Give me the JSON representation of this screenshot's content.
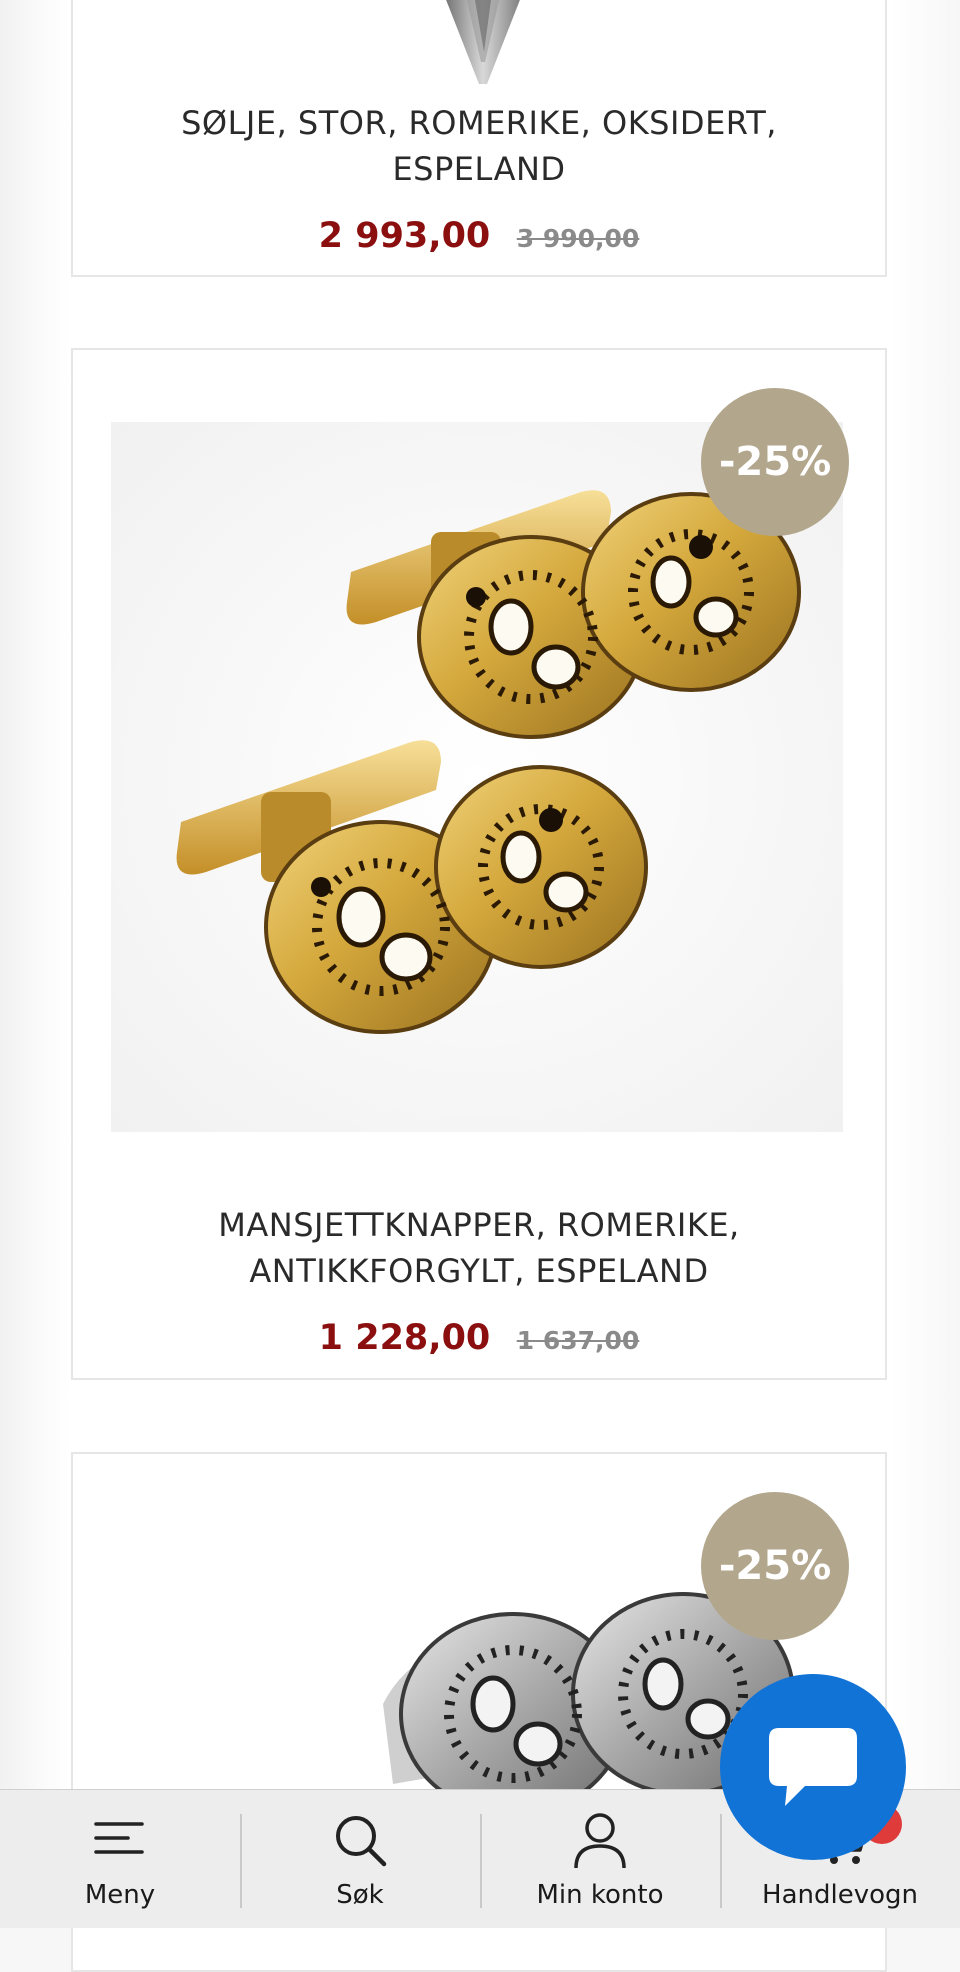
{
  "products": [
    {
      "title": "SØLJE, STOR, ROMERIKE, OKSIDERT, ESPELAND",
      "price": "2 993,00",
      "old_price": "3 990,00"
    },
    {
      "title": "MANSJETTKNAPPER, ROMERIKE, ANTIKKFORGYLT, ESPELAND",
      "price": "1 228,00",
      "old_price": "1 637,00",
      "badge": "-25%"
    },
    {
      "badge": "-25%"
    }
  ],
  "nav": {
    "menu_label": "Meny",
    "search_label": "Søk",
    "account_label": "Min konto",
    "cart_label": "Handlevogn"
  },
  "icons": {
    "menu": "menu-icon",
    "search": "search-icon",
    "account": "user-icon",
    "cart": "cart-icon",
    "chat": "chat-icon"
  },
  "colors": {
    "sale_price": "#8c0f0f",
    "badge": "#b2a68c",
    "chat_button": "#1273d6",
    "cart_dot": "#e03b3b"
  }
}
